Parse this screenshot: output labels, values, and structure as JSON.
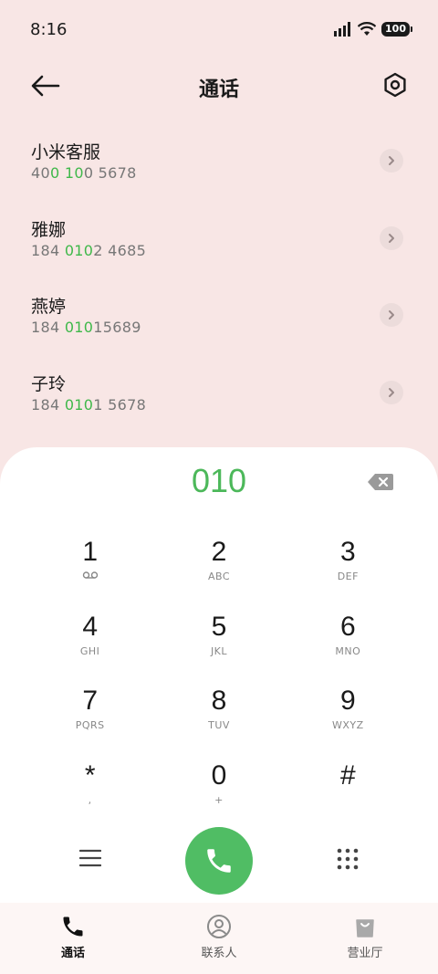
{
  "status_bar": {
    "time": "8:16",
    "battery": "100"
  },
  "header": {
    "title": "通话"
  },
  "contacts": [
    {
      "name": "小米客服",
      "number_parts": [
        "40",
        "0",
        " ",
        "10",
        "0 5678"
      ]
    },
    {
      "name": "雅娜",
      "number_parts": [
        "184 ",
        "010",
        "2 4685",
        "",
        ""
      ]
    },
    {
      "name": "燕婷",
      "number_parts": [
        "184 ",
        "010",
        "15689",
        "",
        ""
      ]
    },
    {
      "name": "子玲",
      "number_parts": [
        "184 ",
        "010",
        "1 5678",
        "",
        ""
      ]
    }
  ],
  "dialpad": {
    "display": "010",
    "keys": [
      [
        {
          "digit": "1",
          "letters": ""
        },
        {
          "digit": "2",
          "letters": "ABC"
        },
        {
          "digit": "3",
          "letters": "DEF"
        }
      ],
      [
        {
          "digit": "4",
          "letters": "GHI"
        },
        {
          "digit": "5",
          "letters": "JKL"
        },
        {
          "digit": "6",
          "letters": "MNO"
        }
      ],
      [
        {
          "digit": "7",
          "letters": "PQRS"
        },
        {
          "digit": "8",
          "letters": "TUV"
        },
        {
          "digit": "9",
          "letters": "WXYZ"
        }
      ],
      [
        {
          "digit": "*",
          "letters": ","
        },
        {
          "digit": "0",
          "letters": "+"
        },
        {
          "digit": "#",
          "letters": ""
        }
      ]
    ]
  },
  "bottom_nav": [
    {
      "label": "通话",
      "icon": "phone-icon",
      "active": true
    },
    {
      "label": "联系人",
      "icon": "contacts-icon",
      "active": false
    },
    {
      "label": "营业厅",
      "icon": "store-bag-icon",
      "active": false
    }
  ],
  "colors": {
    "highlight": "#3fb84a",
    "call_button": "#50bd64",
    "background": "#f8e6e5"
  }
}
